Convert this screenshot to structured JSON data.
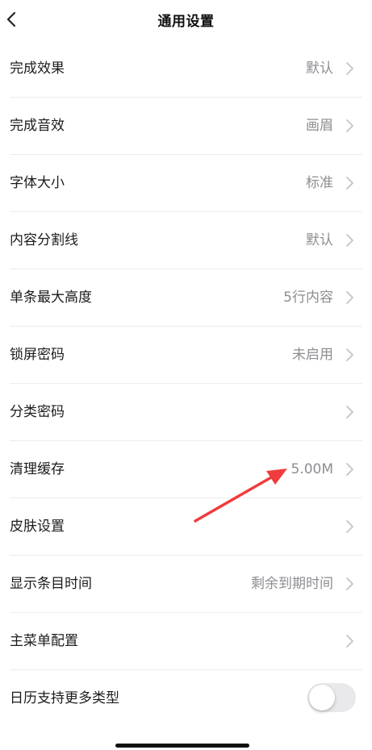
{
  "nav": {
    "title": "通用设置",
    "back_icon": "chevron-left-icon"
  },
  "settings": [
    {
      "label": "完成效果",
      "value": "默认",
      "control": "chevron"
    },
    {
      "label": "完成音效",
      "value": "画眉",
      "control": "chevron"
    },
    {
      "label": "字体大小",
      "value": "标准",
      "control": "chevron"
    },
    {
      "label": "内容分割线",
      "value": "默认",
      "control": "chevron"
    },
    {
      "label": "单条最大高度",
      "value": "5行内容",
      "control": "chevron"
    },
    {
      "label": "锁屏密码",
      "value": "未启用",
      "control": "chevron"
    },
    {
      "label": "分类密码",
      "value": "",
      "control": "chevron"
    },
    {
      "label": "清理缓存",
      "value": "5.00M",
      "control": "chevron"
    },
    {
      "label": "皮肤设置",
      "value": "",
      "control": "chevron"
    },
    {
      "label": "显示条目时间",
      "value": "剩余到期时间",
      "control": "chevron"
    },
    {
      "label": "主菜单配置",
      "value": "",
      "control": "chevron"
    },
    {
      "label": "日历支持更多类型",
      "value": "",
      "control": "toggle",
      "toggle_on": false
    }
  ],
  "colors": {
    "annotation_arrow": "#f03c3c",
    "secondary_text": "#8e8e93",
    "toggle_off": "#e9e9eb"
  }
}
